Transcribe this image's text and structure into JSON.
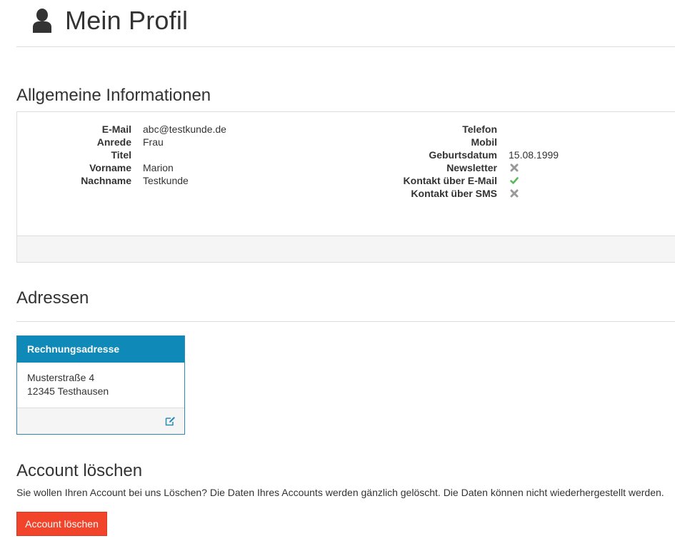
{
  "page": {
    "title": "Mein Profil",
    "icon": "user-icon"
  },
  "general": {
    "title": "Allgemeine Informationen",
    "left": [
      {
        "label": "E-Mail",
        "value": "abc@testkunde.de"
      },
      {
        "label": "Anrede",
        "value": "Frau"
      },
      {
        "label": "Titel",
        "value": ""
      },
      {
        "label": "Vorname",
        "value": "Marion"
      },
      {
        "label": "Nachname",
        "value": "Testkunde"
      }
    ],
    "right": [
      {
        "label": "Telefon",
        "value": ""
      },
      {
        "label": "Mobil",
        "value": ""
      },
      {
        "label": "Geburtsdatum",
        "value": "15.08.1999"
      },
      {
        "label": "Newsletter",
        "icon": "cross-icon"
      },
      {
        "label": "Kontakt über E-Mail",
        "icon": "check-icon"
      },
      {
        "label": "Kontakt über SMS",
        "icon": "cross-icon"
      }
    ]
  },
  "addresses": {
    "title": "Adressen",
    "cards": [
      {
        "heading": "Rechnungsadresse",
        "line1": "Musterstraße 4",
        "line2": "12345 Testhausen",
        "edit_icon": "edit-icon"
      }
    ]
  },
  "delete": {
    "title": "Account löschen",
    "text": "Sie wollen Ihren Account bei uns Löschen? Die Daten Ihres Accounts werden gänzlich gelöscht. Die Daten können nicht wiederhergestellt werden.",
    "button_label": "Account löschen"
  },
  "colors": {
    "primary": "#0f8ab8",
    "danger": "#f1442a",
    "check": "#5cb85c",
    "cross": "#999999"
  }
}
